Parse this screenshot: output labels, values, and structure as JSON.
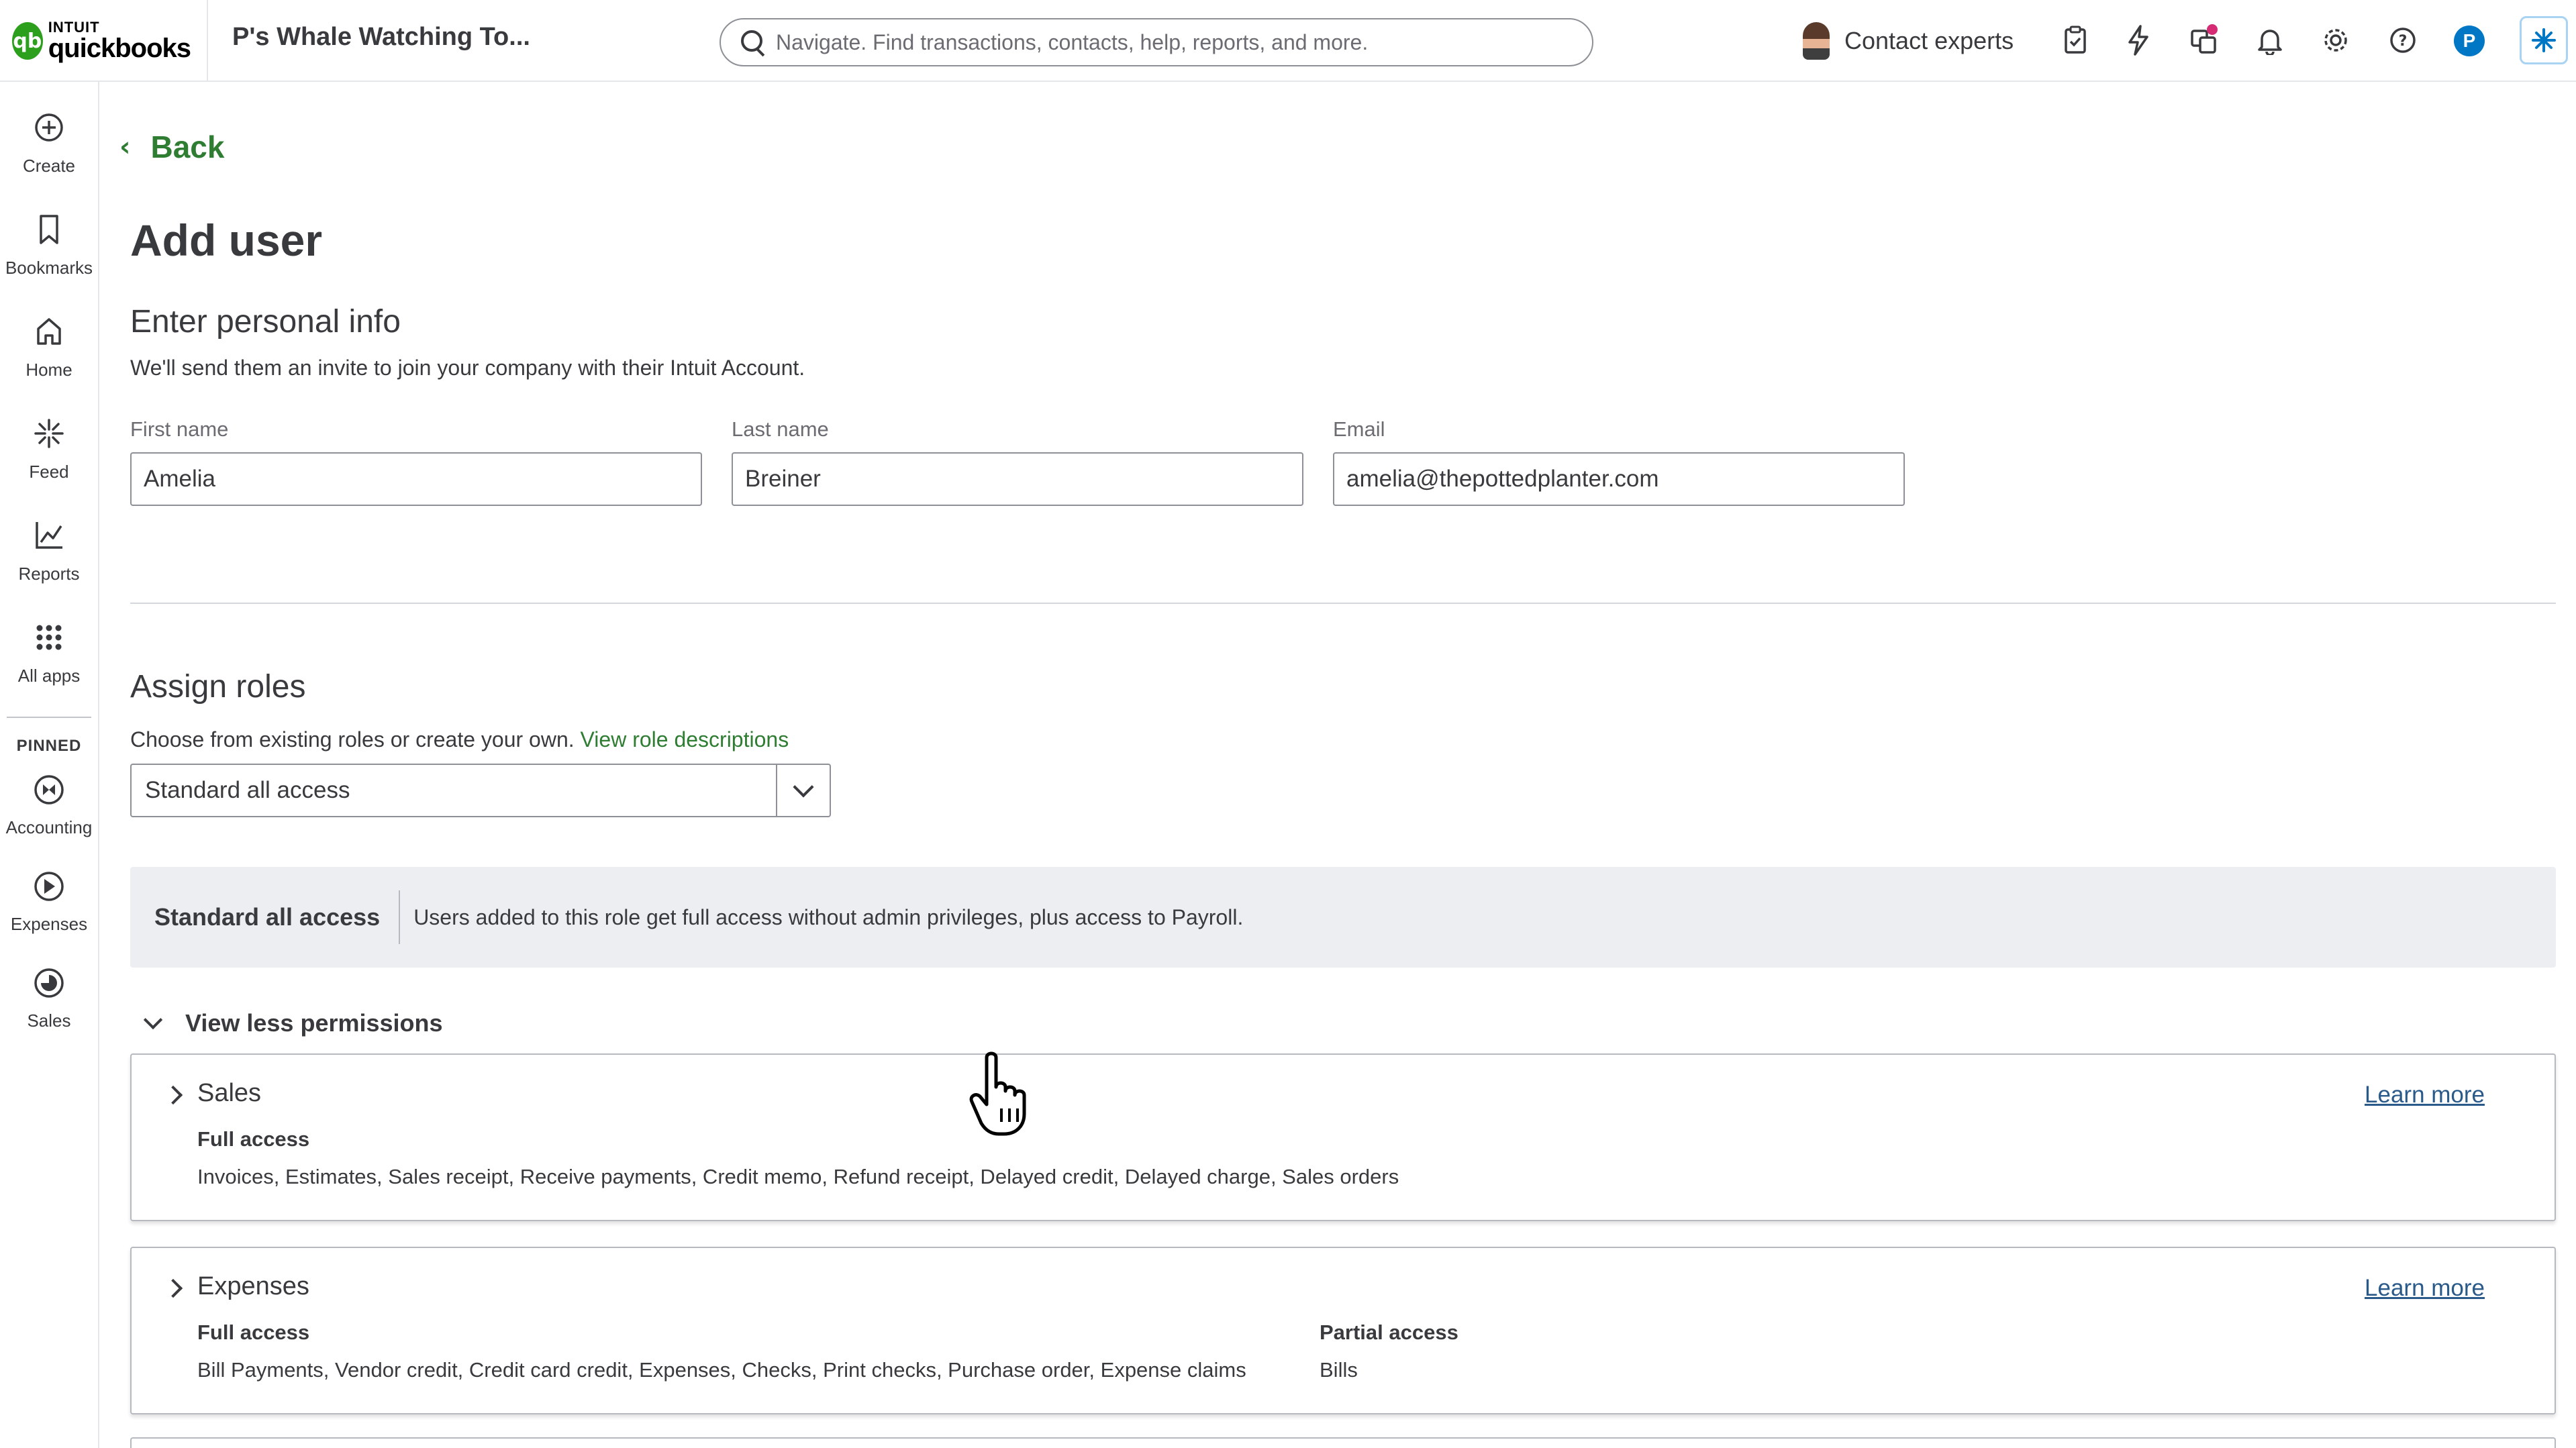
{
  "header": {
    "logo_line1": "INTUIT",
    "logo_line2": "quickbooks",
    "company_name": "P's Whale Watching To...",
    "search_placeholder": "Navigate. Find transactions, contacts, help, reports, and more.",
    "contact_experts": "Contact experts",
    "profile_initial": "P",
    "icons": [
      "clipboard-icon",
      "lightning-icon",
      "apps-hub-icon",
      "bell-icon",
      "gear-icon",
      "help-icon",
      "assist-icon"
    ]
  },
  "leftnav": {
    "items": [
      {
        "label": "Create",
        "icon": "plus-circle-icon"
      },
      {
        "label": "Bookmarks",
        "icon": "bookmark-icon"
      },
      {
        "label": "Home",
        "icon": "home-icon"
      },
      {
        "label": "Feed",
        "icon": "sparkle-icon"
      },
      {
        "label": "Reports",
        "icon": "chart-line-icon"
      },
      {
        "label": "All apps",
        "icon": "grid-icon"
      }
    ],
    "pinned_label": "PINNED",
    "pinned": [
      {
        "label": "Accounting",
        "icon": "accounting-icon"
      },
      {
        "label": "Expenses",
        "icon": "expenses-icon"
      },
      {
        "label": "Sales",
        "icon": "sales-icon"
      }
    ]
  },
  "main": {
    "back_label": "Back",
    "title": "Add user",
    "personal": {
      "title": "Enter personal info",
      "desc": "We'll send them an invite to join your company with their Intuit Account.",
      "first_name_label": "First name",
      "first_name_value": "Amelia",
      "last_name_label": "Last name",
      "last_name_value": "Breiner",
      "email_label": "Email",
      "email_value": "amelia@thepottedplanter.com"
    },
    "roles": {
      "title": "Assign roles",
      "desc": "Choose from existing roles or create your own.",
      "desc_link": "View role descriptions",
      "selected_role": "Standard all access",
      "banner_name": "Standard all access",
      "banner_desc": "Users added to this role get full access without admin privileges, plus access to Payroll."
    },
    "permissions_toggle": "View less permissions",
    "permissions": [
      {
        "title": "Sales",
        "learn_more": "Learn more",
        "full_access_label": "Full access",
        "full_access_items": "Invoices, Estimates, Sales receipt, Receive payments, Credit memo, Refund receipt, Delayed credit, Delayed charge, Sales orders"
      },
      {
        "title": "Expenses",
        "learn_more": "Learn more",
        "full_access_label": "Full access",
        "full_access_items": "Bill Payments, Vendor credit, Credit card credit, Expenses, Checks, Print checks, Purchase order, Expense claims",
        "partial_access_label": "Partial access",
        "partial_access_items": "Bills"
      }
    ]
  },
  "colors": {
    "brand_green": "#2ca01c",
    "link_green": "#2e7d32",
    "learn_more_blue": "#2a5a8a",
    "banner_bg": "#eceef1"
  }
}
